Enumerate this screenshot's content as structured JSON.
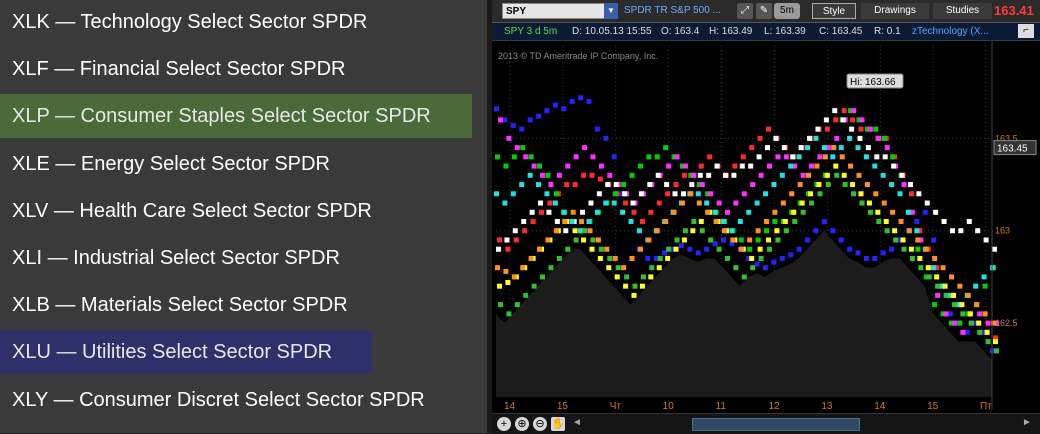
{
  "legend": {
    "items": [
      {
        "label": "XLK — Technology Select Sector SPDR",
        "color": "#3a3a3a"
      },
      {
        "label": "XLF — Financial Select Sector SPDR",
        "color": "#3a3a3a"
      },
      {
        "label": "XLP — Consumer Staples Select Sector SPDR",
        "color": "#4a6a3a"
      },
      {
        "label": "XLE — Energy Select Sector SPDR",
        "color": "#3a3a3a"
      },
      {
        "label": "XLV — Health Care Select Sector SPDR",
        "color": "#3a3a3a"
      },
      {
        "label": "XLI — Industrial Select Sector SPDR",
        "color": "#3a3a3a"
      },
      {
        "label": "XLB — Materials Select Sector SPDR",
        "color": "#3a3a3a"
      },
      {
        "label": "XLU — Utilities Select Sector SPDR",
        "color": "#2f2f6a"
      },
      {
        "label": "XLY — Consumer Discret Select Sector SPDR",
        "color": "#3a3a3a"
      }
    ]
  },
  "toolbar": {
    "symbol": "SPY",
    "dropdown": "▼",
    "symbol_desc": "SPDR TR S&P 500 ...",
    "aggregation": "5m",
    "style_label": "Style",
    "drawings_label": "Drawings",
    "studies_label": "Studies",
    "last_price": "163.41",
    "last_price_color": "#ff3a3a"
  },
  "infobar": {
    "period": "SPY 3 d 5m",
    "date": "D: 10.05.13 15:55",
    "open": "O: 163.4",
    "high": "H: 163.49",
    "low": "L: 163.39",
    "close": "C: 163.45",
    "ratio": "R: 0.1",
    "study": "zTechnology (X..."
  },
  "chart_data": {
    "type": "scatter",
    "copyright": "2013 © TD Ameritrade IP Company, Inc.",
    "hi_label": "Hi: 163.66",
    "price_tag": "163.45",
    "y_ticks": [
      "163.5",
      "163",
      "162.5"
    ],
    "y_tick_values": [
      163.5,
      163,
      162.5
    ],
    "ylim": [
      162.1,
      164.0
    ],
    "x_ticks": [
      "14",
      "15",
      "Чт",
      "10",
      "11",
      "12",
      "13",
      "14",
      "15",
      "Пт"
    ],
    "grid": true,
    "series": [
      {
        "color": "#2323ff",
        "y": [
          163.66,
          163.6,
          163.57,
          163.55,
          163.6,
          163.62,
          163.65,
          163.68,
          163.66,
          163.7,
          163.72,
          163.7,
          163.55,
          163.5,
          163.4,
          163.2,
          163.05,
          162.9,
          162.85,
          162.85,
          162.88,
          162.9,
          162.92,
          162.9,
          162.88,
          162.9,
          162.93,
          162.95,
          162.93,
          162.9,
          162.85,
          162.82,
          162.8,
          162.83,
          162.85,
          162.87,
          162.9,
          162.95,
          163.0,
          163.05,
          163.0,
          162.95,
          162.9,
          162.88,
          162.85,
          162.85,
          162.88,
          162.9,
          162.95,
          163.0,
          163.05,
          163.1,
          162.95,
          162.7,
          162.55,
          162.5,
          162.45,
          162.5,
          162.45,
          162.35
        ]
      },
      {
        "color": "#ff2a2a",
        "y": [
          162.95,
          162.9,
          162.95,
          163.0,
          163.05,
          163.1,
          163.15,
          163.2,
          163.25,
          163.25,
          163.3,
          163.3,
          163.28,
          163.25,
          163.2,
          163.15,
          163.1,
          163.05,
          163.1,
          163.15,
          163.2,
          163.25,
          163.3,
          163.3,
          163.35,
          163.4,
          163.35,
          163.3,
          163.35,
          163.4,
          163.45,
          163.5,
          163.55,
          163.5,
          163.45,
          163.4,
          163.45,
          163.5,
          163.55,
          163.55,
          163.6,
          163.65,
          163.6,
          163.55,
          163.55,
          163.5,
          163.5,
          163.4,
          163.3,
          163.2,
          163.0,
          162.9,
          162.8,
          162.7,
          162.65,
          162.6,
          162.55,
          162.5,
          162.45,
          162.42
        ]
      },
      {
        "color": "#00d000",
        "y": [
          163.4,
          163.35,
          163.4,
          163.45,
          163.4,
          163.35,
          163.3,
          163.2,
          163.1,
          163.05,
          163.0,
          163.05,
          163.1,
          163.15,
          163.2,
          163.25,
          163.3,
          163.35,
          163.4,
          163.4,
          163.45,
          163.4,
          163.35,
          163.3,
          163.25,
          163.2,
          163.1,
          163.05,
          163.0,
          162.95,
          162.9,
          162.95,
          163.0,
          163.05,
          163.05,
          163.1,
          163.15,
          163.2,
          163.25,
          163.3,
          163.45,
          163.6,
          163.65,
          163.6,
          163.55,
          163.55,
          163.5,
          163.4,
          163.3,
          163.1,
          162.9,
          162.75,
          162.6,
          162.55,
          162.5,
          162.5,
          162.55,
          162.6,
          162.7,
          162.8
        ]
      },
      {
        "color": "#ff30ff",
        "y": [
          163.6,
          163.5,
          163.45,
          163.4,
          163.35,
          163.3,
          163.25,
          163.3,
          163.35,
          163.4,
          163.45,
          163.4,
          163.35,
          163.3,
          163.25,
          163.2,
          163.15,
          163.2,
          163.25,
          163.3,
          163.35,
          163.4,
          163.35,
          163.3,
          163.25,
          163.2,
          163.15,
          163.1,
          163.15,
          163.2,
          163.25,
          163.3,
          163.35,
          163.4,
          163.4,
          163.35,
          163.3,
          163.35,
          163.4,
          163.45,
          163.5,
          163.6,
          163.65,
          163.6,
          163.55,
          163.5,
          163.45,
          163.35,
          163.25,
          163.1,
          162.95,
          162.8,
          162.65,
          162.55,
          162.5,
          162.45,
          162.5,
          162.55,
          162.5,
          162.5
        ]
      },
      {
        "color": "#ffffff",
        "y": [
          162.9,
          162.95,
          163.0,
          163.05,
          163.1,
          163.15,
          163.1,
          163.05,
          163.0,
          163.05,
          163.1,
          163.15,
          163.2,
          163.25,
          163.25,
          163.2,
          163.15,
          163.2,
          163.25,
          163.3,
          163.25,
          163.2,
          163.2,
          163.25,
          163.3,
          163.3,
          163.35,
          163.3,
          163.3,
          163.35,
          163.35,
          163.4,
          163.45,
          163.5,
          163.45,
          163.4,
          163.45,
          163.5,
          163.55,
          163.6,
          163.65,
          163.6,
          163.55,
          163.5,
          163.45,
          163.4,
          163.4,
          163.35,
          163.3,
          163.25,
          163.2,
          163.15,
          163.1,
          163.05,
          163.0,
          163.0,
          163.05,
          163.0,
          162.95,
          162.9
        ]
      },
      {
        "color": "#20e0e0",
        "y": [
          163.2,
          163.15,
          163.2,
          163.25,
          163.3,
          163.25,
          163.2,
          163.15,
          163.1,
          163.05,
          163.0,
          163.05,
          163.1,
          163.15,
          163.15,
          163.1,
          163.05,
          163.0,
          162.95,
          163.0,
          163.05,
          163.1,
          163.15,
          163.2,
          163.2,
          163.15,
          163.1,
          163.05,
          163.0,
          163.05,
          163.1,
          163.15,
          163.2,
          163.25,
          163.3,
          163.35,
          163.4,
          163.45,
          163.5,
          163.45,
          163.4,
          163.45,
          163.5,
          163.45,
          163.4,
          163.35,
          163.3,
          163.25,
          163.2,
          163.1,
          163.0,
          162.9,
          162.8,
          162.7,
          162.65,
          162.6,
          162.65,
          162.7,
          162.75,
          162.8
        ]
      },
      {
        "color": "#ffff20",
        "y": [
          162.7,
          162.72,
          162.75,
          162.8,
          162.85,
          162.9,
          162.95,
          163.0,
          163.05,
          163.0,
          162.95,
          162.9,
          162.85,
          162.8,
          162.75,
          162.7,
          162.65,
          162.7,
          162.75,
          162.8,
          162.85,
          162.9,
          162.95,
          163.0,
          163.05,
          163.1,
          163.05,
          163.0,
          162.95,
          162.9,
          162.85,
          162.9,
          162.95,
          163.0,
          163.05,
          163.1,
          163.15,
          163.2,
          163.25,
          163.3,
          163.35,
          163.3,
          163.25,
          163.2,
          163.15,
          163.1,
          163.05,
          163.0,
          162.95,
          162.9,
          162.85,
          162.8,
          162.75,
          162.7,
          162.65,
          162.6,
          162.55,
          162.5,
          162.45,
          162.4
        ]
      },
      {
        "color": "#ff9020",
        "y": [
          162.8,
          162.78,
          162.75,
          162.8,
          162.85,
          162.9,
          162.95,
          163.0,
          163.05,
          163.1,
          163.05,
          163.0,
          162.95,
          162.9,
          162.85,
          162.8,
          162.85,
          162.9,
          162.95,
          163.0,
          163.05,
          163.1,
          163.15,
          163.2,
          163.15,
          163.1,
          163.05,
          163.0,
          162.95,
          162.9,
          162.95,
          163.0,
          163.05,
          163.1,
          163.15,
          163.2,
          163.25,
          163.3,
          163.35,
          163.4,
          163.45,
          163.4,
          163.35,
          163.3,
          163.25,
          163.2,
          163.15,
          163.1,
          163.05,
          163.0,
          162.95,
          162.9,
          162.85,
          162.8,
          162.75,
          162.7,
          162.65,
          162.6,
          162.55,
          162.5
        ]
      },
      {
        "color": "#30c030",
        "y": [
          162.6,
          162.55,
          162.6,
          162.65,
          162.7,
          162.75,
          162.8,
          162.85,
          162.9,
          162.95,
          163.0,
          162.95,
          162.9,
          162.85,
          162.8,
          162.75,
          162.7,
          162.75,
          162.8,
          162.85,
          162.9,
          162.95,
          163.0,
          163.05,
          163.0,
          162.95,
          162.9,
          162.85,
          162.8,
          162.75,
          162.8,
          162.85,
          162.9,
          162.95,
          163.0,
          163.05,
          163.1,
          163.15,
          163.2,
          163.25,
          163.3,
          163.25,
          163.2,
          163.15,
          163.1,
          163.05,
          163.0,
          162.95,
          162.9,
          162.85,
          162.8,
          162.75,
          162.7,
          162.65,
          162.6,
          162.55,
          162.5,
          162.45,
          162.4,
          162.35
        ]
      }
    ]
  },
  "nav": {
    "zoom_fit": "+",
    "zoom_in": "⊕",
    "zoom_out": "⊖",
    "pan": "✋",
    "left": "◄",
    "right": "►"
  }
}
